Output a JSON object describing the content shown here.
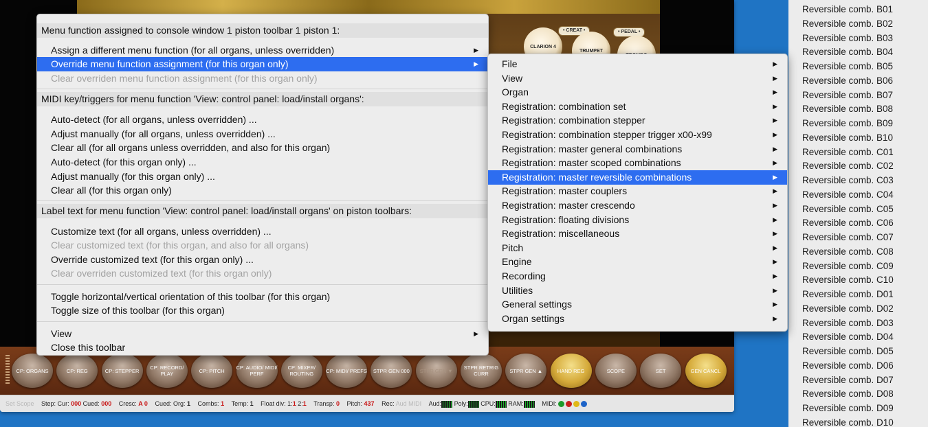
{
  "main_menu": {
    "sections": [
      {
        "header": "Menu function assigned to console window 1 piston toolbar 1 piston 1:",
        "items": [
          {
            "label": "Assign a different menu function (for all organs, unless overridden)",
            "submenu": true,
            "state": "normal"
          },
          {
            "label": "Override menu function assignment (for this organ only)",
            "submenu": true,
            "state": "selected"
          },
          {
            "label": "Clear overriden menu function assignment (for this organ only)",
            "submenu": false,
            "state": "disabled"
          }
        ]
      },
      {
        "header": "MIDI key/triggers for menu function 'View: control panel: load/install organs':",
        "items": [
          {
            "label": "Auto-detect (for all organs, unless overridden) ...",
            "state": "normal"
          },
          {
            "label": "Adjust manually (for all organs, unless overridden) ...",
            "state": "normal"
          },
          {
            "label": "Clear all (for all organs unless overridden, and also for this organ)",
            "state": "normal"
          },
          {
            "label": "Auto-detect (for this organ only) ...",
            "state": "normal"
          },
          {
            "label": "Adjust manually (for this organ only) ...",
            "state": "normal"
          },
          {
            "label": "Clear all (for this organ only)",
            "state": "normal"
          }
        ]
      },
      {
        "header": "Label text for menu function 'View: control panel: load/install organs' on piston toolbars:",
        "items": [
          {
            "label": "Customize text (for all organs, unless overridden) ...",
            "state": "normal"
          },
          {
            "label": "Clear customized text (for this organ, and also for all organs)",
            "state": "disabled"
          },
          {
            "label": "Override customized text (for this organ only) ...",
            "state": "normal"
          },
          {
            "label": "Clear overriden customized text (for this organ only)",
            "state": "disabled"
          }
        ]
      }
    ],
    "toggle_items": [
      {
        "label": "Toggle horizontal/vertical orientation of this toolbar (for this organ)"
      },
      {
        "label": "Toggle size of this toolbar (for this organ)"
      }
    ],
    "bottom_items": [
      {
        "label": "View",
        "submenu": true
      },
      {
        "label": "Close this toolbar",
        "submenu": false
      }
    ]
  },
  "submenu": {
    "items": [
      {
        "label": "File",
        "selected": false
      },
      {
        "label": "View",
        "selected": false
      },
      {
        "label": "Organ",
        "selected": false
      },
      {
        "label": "Registration: combination set",
        "selected": false
      },
      {
        "label": "Registration: combination stepper",
        "selected": false
      },
      {
        "label": "Registration: combination stepper trigger x00-x99",
        "selected": false
      },
      {
        "label": "Registration: master general combinations",
        "selected": false
      },
      {
        "label": "Registration: master scoped combinations",
        "selected": false
      },
      {
        "label": "Registration: master reversible combinations",
        "selected": true
      },
      {
        "label": "Registration: master couplers",
        "selected": false
      },
      {
        "label": "Registration: master crescendo",
        "selected": false
      },
      {
        "label": "Registration: floating divisions",
        "selected": false
      },
      {
        "label": "Registration: miscellaneous",
        "selected": false
      },
      {
        "label": "Pitch",
        "selected": false
      },
      {
        "label": "Engine",
        "selected": false
      },
      {
        "label": "Recording",
        "selected": false
      },
      {
        "label": "Utilities",
        "selected": false
      },
      {
        "label": "General settings",
        "selected": false
      },
      {
        "label": "Organ settings",
        "selected": false
      }
    ]
  },
  "reversible_list": [
    "Reversible comb. B01",
    "Reversible comb. B02",
    "Reversible comb. B03",
    "Reversible comb. B04",
    "Reversible comb. B05",
    "Reversible comb. B06",
    "Reversible comb. B07",
    "Reversible comb. B08",
    "Reversible comb. B09",
    "Reversible comb. B10",
    "Reversible comb. C01",
    "Reversible comb. C02",
    "Reversible comb. C03",
    "Reversible comb. C04",
    "Reversible comb. C05",
    "Reversible comb. C06",
    "Reversible comb. C07",
    "Reversible comb. C08",
    "Reversible comb. C09",
    "Reversible comb. C10",
    "Reversible comb. D01",
    "Reversible comb. D02",
    "Reversible comb. D03",
    "Reversible comb. D04",
    "Reversible comb. D05",
    "Reversible comb. D06",
    "Reversible comb. D07",
    "Reversible comb. D08",
    "Reversible comb. D09",
    "Reversible comb. D10"
  ],
  "organ": {
    "stops": [
      "CLARION 4",
      "TRUMPET",
      "TROMBO"
    ],
    "division_labels": [
      "• CREAT •",
      "• PEDAL •"
    ]
  },
  "pistons": [
    {
      "label": "CP: ORGANS",
      "style": "normal"
    },
    {
      "label": "CP: REG",
      "style": "normal"
    },
    {
      "label": "CP: STEPPER",
      "style": "normal"
    },
    {
      "label": "CP: RECORD/ PLAY",
      "style": "normal"
    },
    {
      "label": "CP: PITCH",
      "style": "normal"
    },
    {
      "label": "CP: AUDIO/ MIDI/ PERF",
      "style": "normal"
    },
    {
      "label": "CP: MIXER/ ROUTING",
      "style": "normal"
    },
    {
      "label": "CP: MIDI/ PREFS",
      "style": "normal"
    },
    {
      "label": "STPR GEN 000",
      "style": "normal"
    },
    {
      "label": "STPR GEN ▼",
      "style": "dim"
    },
    {
      "label": "STPR RETRIG CURR",
      "style": "normal"
    },
    {
      "label": "STPR GEN ▲",
      "style": "normal"
    },
    {
      "label": "HAND REG",
      "style": "gold"
    },
    {
      "label": "SCOPE",
      "style": "normal"
    },
    {
      "label": "SET",
      "style": "normal"
    },
    {
      "label": "GEN CANCL",
      "style": "gold"
    }
  ],
  "status": {
    "set_scope": "Set Scope",
    "step_label": "Step: Cur:",
    "step_cur": "000",
    "cued_label": "Cued:",
    "step_cued": "000",
    "cresc_label": "Cresc:",
    "cresc": "A 0",
    "cued_org_label": "Cued: Org:",
    "cued_org": "1",
    "combs_label": "Combs:",
    "combs": "1",
    "temp_label": "Temp:",
    "temp": "1",
    "float_label": "Float div: 1:",
    "float_1": "1",
    "float_2_label": "2:",
    "float_2": "1",
    "transp_label": "Transp:",
    "transp": "0",
    "pitch_label": "Pitch:",
    "pitch": "437",
    "rec_label": "Rec:",
    "rec_value": "Aud MIDI",
    "aud_label": "Aud:",
    "poly_label": "Poly:",
    "cpu_label": "CPU:",
    "ram_label": "RAM:",
    "midi_label": "MIDI:",
    "led_colors": [
      "#1d9a2a",
      "#c81e1e",
      "#e0b818",
      "#1e64c8"
    ]
  }
}
